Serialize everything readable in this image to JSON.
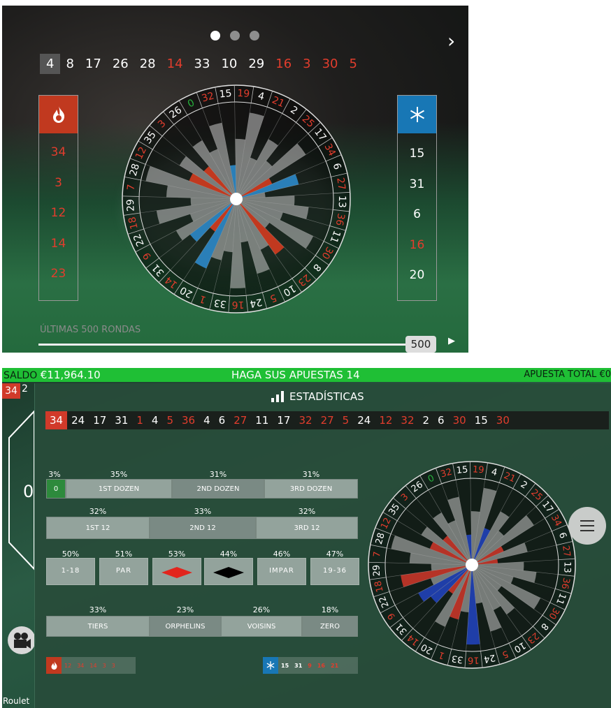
{
  "top_panel": {
    "carousel_dots": 3,
    "next_icon": "chevron-right-icon",
    "history": [
      {
        "n": "4",
        "c": "black"
      },
      {
        "n": "8",
        "c": "black"
      },
      {
        "n": "17",
        "c": "black"
      },
      {
        "n": "26",
        "c": "black"
      },
      {
        "n": "28",
        "c": "black"
      },
      {
        "n": "14",
        "c": "red"
      },
      {
        "n": "33",
        "c": "black"
      },
      {
        "n": "10",
        "c": "black"
      },
      {
        "n": "29",
        "c": "black"
      },
      {
        "n": "16",
        "c": "red"
      },
      {
        "n": "3",
        "c": "red"
      },
      {
        "n": "30",
        "c": "red"
      },
      {
        "n": "5",
        "c": "red"
      }
    ],
    "hot_icon": "fire-icon",
    "hot_numbers": [
      "34",
      "3",
      "12",
      "14",
      "23"
    ],
    "cold_icon": "snowflake-icon",
    "cold_numbers": [
      {
        "n": "15",
        "c": "black"
      },
      {
        "n": "31",
        "c": "black"
      },
      {
        "n": "6",
        "c": "black"
      },
      {
        "n": "16",
        "c": "red"
      },
      {
        "n": "20",
        "c": "black"
      }
    ],
    "rounds_label": "ÚLTIMAS 500 RONDAS",
    "slider_value": "500",
    "slider_fraction": 1.0,
    "play_icon": "play-icon"
  },
  "status_bar": {
    "saldo_label": "SALDO",
    "saldo_value": "€11,964.10",
    "message": "HAGA SUS APUESTAS 14",
    "total_label": "APUESTA TOTAL",
    "total_value": "€0"
  },
  "last_numbers": {
    "first": "34",
    "second": "2"
  },
  "stats_panel": {
    "title": "ESTADÍSTICAS",
    "title_icon": "bar-chart-icon",
    "history": [
      {
        "n": "34",
        "c": "red"
      },
      {
        "n": "24",
        "c": "black"
      },
      {
        "n": "17",
        "c": "black"
      },
      {
        "n": "31",
        "c": "black"
      },
      {
        "n": "1",
        "c": "red"
      },
      {
        "n": "4",
        "c": "black"
      },
      {
        "n": "5",
        "c": "red"
      },
      {
        "n": "36",
        "c": "red"
      },
      {
        "n": "4",
        "c": "black"
      },
      {
        "n": "6",
        "c": "black"
      },
      {
        "n": "27",
        "c": "red"
      },
      {
        "n": "11",
        "c": "black"
      },
      {
        "n": "17",
        "c": "black"
      },
      {
        "n": "32",
        "c": "red"
      },
      {
        "n": "27",
        "c": "red"
      },
      {
        "n": "5",
        "c": "red"
      },
      {
        "n": "24",
        "c": "black"
      },
      {
        "n": "12",
        "c": "red"
      },
      {
        "n": "32",
        "c": "red"
      },
      {
        "n": "2",
        "c": "black"
      },
      {
        "n": "6",
        "c": "black"
      },
      {
        "n": "30",
        "c": "red"
      },
      {
        "n": "15",
        "c": "black"
      },
      {
        "n": "30",
        "c": "red"
      }
    ],
    "dozens": {
      "pcts": [
        "3%",
        "35%",
        "31%",
        "31%"
      ],
      "labels": [
        "0",
        "1ST DOZEN",
        "2ND DOZEN",
        "3RD DOZEN"
      ]
    },
    "columns": {
      "pcts": [
        "32%",
        "33%",
        "32%"
      ],
      "labels": [
        "1ST 12",
        "2ND 12",
        "3RD 12"
      ]
    },
    "even_chances": {
      "pcts": [
        "50%",
        "51%",
        "53%",
        "44%",
        "46%",
        "47%"
      ],
      "labels": [
        "1-18",
        "PAR",
        "",
        "",
        "IMPAR",
        "19-36"
      ]
    },
    "sectors": {
      "pcts": [
        "33%",
        "23%",
        "26%",
        "18%"
      ],
      "labels": [
        "TIERS",
        "ORPHELINS",
        "VOISINS",
        "ZERO"
      ]
    },
    "hot_strip": [
      "12",
      "34",
      "14",
      "3",
      "3"
    ],
    "cold_strip": [
      {
        "n": "15",
        "c": "black"
      },
      {
        "n": "31",
        "c": "black"
      },
      {
        "n": "9",
        "c": "red"
      },
      {
        "n": "16",
        "c": "red"
      },
      {
        "n": "21",
        "c": "red"
      }
    ]
  },
  "side": {
    "camera_icon": "camera-icon",
    "menu_icon": "menu-icon",
    "game_label": "Roulet"
  },
  "colors": {
    "red": "#e23d2d",
    "green_bar": "#1fbf35",
    "hot": "#c1391f",
    "cold": "#1877b5"
  },
  "wheel_order": [
    "0",
    "32",
    "15",
    "19",
    "4",
    "21",
    "2",
    "25",
    "17",
    "34",
    "6",
    "27",
    "13",
    "36",
    "11",
    "30",
    "8",
    "23",
    "10",
    "5",
    "24",
    "16",
    "33",
    "1",
    "20",
    "14",
    "31",
    "9",
    "22",
    "18",
    "29",
    "7",
    "28",
    "12",
    "35",
    "3",
    "26"
  ]
}
